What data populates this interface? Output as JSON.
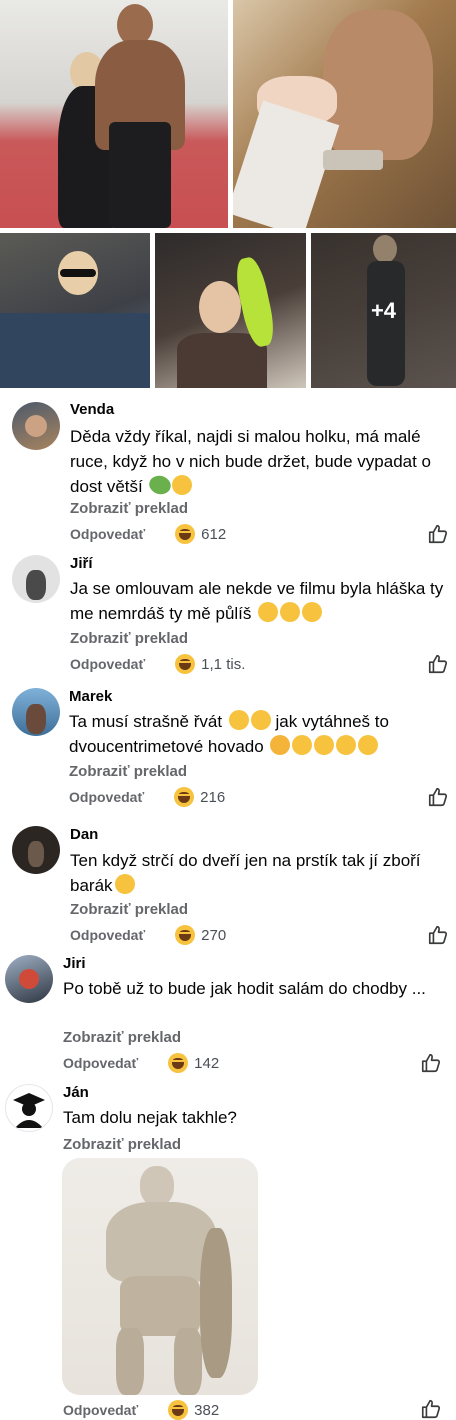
{
  "gallery": {
    "more_label": "+4"
  },
  "comments": [
    {
      "author": "Venda",
      "text": "Děda vždy říkal, najdi si malou holku, má malé ruce, když ho v nich bude držet, bude vypadat o dost větší",
      "translate_label": "Zobraziť preklad",
      "reply_label": "Odpovedať",
      "reaction_count": "612"
    },
    {
      "author": "Jiří",
      "text": "Ja se omlouvam ale nekde ve filmu byla hláška ty me nemrdáš ty mě půlíš",
      "translate_label": "Zobraziť preklad",
      "reply_label": "Odpovedať",
      "reaction_count": "1,1 tis."
    },
    {
      "author": "Marek",
      "text_line1": "Ta musí strašně řvát",
      "text_line1_end": "jak vytáhneš to",
      "text_line2": "dvoucentrimetové hovado",
      "translate_label": "Zobraziť preklad",
      "reply_label": "Odpovedať",
      "reaction_count": "216"
    },
    {
      "author": "Dan",
      "text": "Ten když strčí do dveří jen na prstík tak jí zboří barák",
      "translate_label": "Zobraziť preklad",
      "reply_label": "Odpovedať",
      "reaction_count": "270"
    },
    {
      "author": "Jiri",
      "text": "Po tobě už to bude jak hodit salám do chodby ...",
      "translate_label": "Zobraziť preklad",
      "reply_label": "Odpovedať",
      "reaction_count": "142"
    },
    {
      "author": "Ján",
      "text": "Tam dolu nejak takhle?",
      "translate_label": "Zobraziť preklad",
      "reply_label": "Odpovedať",
      "reaction_count": "382"
    }
  ],
  "icons": {
    "reaction": "laughing-face-icon",
    "like": "thumbs-up-outline-icon"
  },
  "colors": {
    "meta_gray": "#65676b",
    "reaction_yellow": "#f7c33e"
  }
}
